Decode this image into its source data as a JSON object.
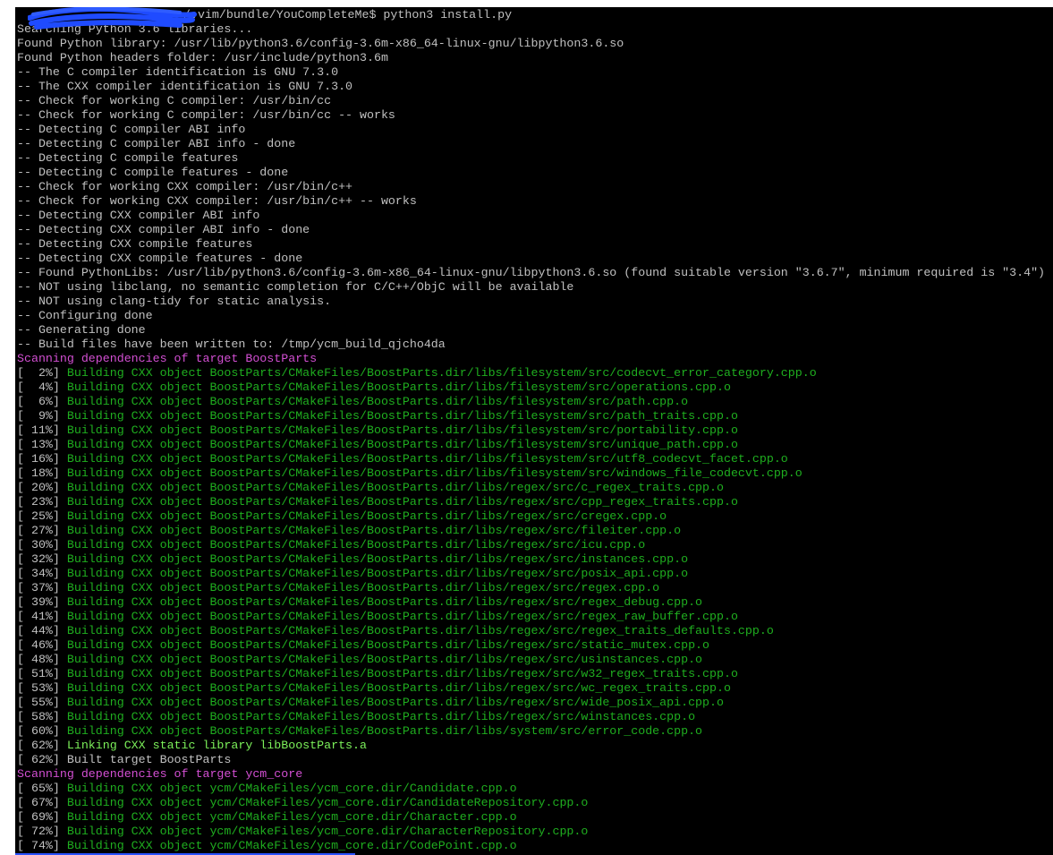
{
  "prompt": {
    "path": "/.vim/bundle/YouCompleteMe$ python3 install.py",
    "redaction_color": "#1f4bff"
  },
  "colors": {
    "background": "#000000",
    "default": "#c0c0c0",
    "magenta": "#d34fd3",
    "green": "#1fae1f",
    "bright_green": "#7cf05a"
  },
  "lines": [
    {
      "progress": "",
      "text": "Searching Python 3.6 libraries...",
      "color": "default"
    },
    {
      "progress": "",
      "text": "Found Python library: /usr/lib/python3.6/config-3.6m-x86_64-linux-gnu/libpython3.6.so",
      "color": "default"
    },
    {
      "progress": "",
      "text": "Found Python headers folder: /usr/include/python3.6m",
      "color": "default"
    },
    {
      "progress": "",
      "text": "-- The C compiler identification is GNU 7.3.0",
      "color": "default"
    },
    {
      "progress": "",
      "text": "-- The CXX compiler identification is GNU 7.3.0",
      "color": "default"
    },
    {
      "progress": "",
      "text": "-- Check for working C compiler: /usr/bin/cc",
      "color": "default"
    },
    {
      "progress": "",
      "text": "-- Check for working C compiler: /usr/bin/cc -- works",
      "color": "default"
    },
    {
      "progress": "",
      "text": "-- Detecting C compiler ABI info",
      "color": "default"
    },
    {
      "progress": "",
      "text": "-- Detecting C compiler ABI info - done",
      "color": "default"
    },
    {
      "progress": "",
      "text": "-- Detecting C compile features",
      "color": "default"
    },
    {
      "progress": "",
      "text": "-- Detecting C compile features - done",
      "color": "default"
    },
    {
      "progress": "",
      "text": "-- Check for working CXX compiler: /usr/bin/c++",
      "color": "default"
    },
    {
      "progress": "",
      "text": "-- Check for working CXX compiler: /usr/bin/c++ -- works",
      "color": "default"
    },
    {
      "progress": "",
      "text": "-- Detecting CXX compiler ABI info",
      "color": "default"
    },
    {
      "progress": "",
      "text": "-- Detecting CXX compiler ABI info - done",
      "color": "default"
    },
    {
      "progress": "",
      "text": "-- Detecting CXX compile features",
      "color": "default"
    },
    {
      "progress": "",
      "text": "-- Detecting CXX compile features - done",
      "color": "default"
    },
    {
      "progress": "",
      "text": "-- Found PythonLibs: /usr/lib/python3.6/config-3.6m-x86_64-linux-gnu/libpython3.6.so (found suitable version \"3.6.7\", minimum required is \"3.4\")",
      "color": "default"
    },
    {
      "progress": "",
      "text": "-- NOT using libclang, no semantic completion for C/C++/ObjC will be available",
      "color": "default"
    },
    {
      "progress": "",
      "text": "-- NOT using clang-tidy for static analysis.",
      "color": "default"
    },
    {
      "progress": "",
      "text": "-- Configuring done",
      "color": "default"
    },
    {
      "progress": "",
      "text": "-- Generating done",
      "color": "default"
    },
    {
      "progress": "",
      "text": "-- Build files have been written to: /tmp/ycm_build_qjcho4da",
      "color": "default"
    },
    {
      "progress": "",
      "text": "Scanning dependencies of target BoostParts",
      "color": "magenta"
    },
    {
      "progress": "[  2%] ",
      "text": "Building CXX object BoostParts/CMakeFiles/BoostParts.dir/libs/filesystem/src/codecvt_error_category.cpp.o",
      "color": "green"
    },
    {
      "progress": "[  4%] ",
      "text": "Building CXX object BoostParts/CMakeFiles/BoostParts.dir/libs/filesystem/src/operations.cpp.o",
      "color": "green"
    },
    {
      "progress": "[  6%] ",
      "text": "Building CXX object BoostParts/CMakeFiles/BoostParts.dir/libs/filesystem/src/path.cpp.o",
      "color": "green"
    },
    {
      "progress": "[  9%] ",
      "text": "Building CXX object BoostParts/CMakeFiles/BoostParts.dir/libs/filesystem/src/path_traits.cpp.o",
      "color": "green"
    },
    {
      "progress": "[ 11%] ",
      "text": "Building CXX object BoostParts/CMakeFiles/BoostParts.dir/libs/filesystem/src/portability.cpp.o",
      "color": "green"
    },
    {
      "progress": "[ 13%] ",
      "text": "Building CXX object BoostParts/CMakeFiles/BoostParts.dir/libs/filesystem/src/unique_path.cpp.o",
      "color": "green"
    },
    {
      "progress": "[ 16%] ",
      "text": "Building CXX object BoostParts/CMakeFiles/BoostParts.dir/libs/filesystem/src/utf8_codecvt_facet.cpp.o",
      "color": "green"
    },
    {
      "progress": "[ 18%] ",
      "text": "Building CXX object BoostParts/CMakeFiles/BoostParts.dir/libs/filesystem/src/windows_file_codecvt.cpp.o",
      "color": "green"
    },
    {
      "progress": "[ 20%] ",
      "text": "Building CXX object BoostParts/CMakeFiles/BoostParts.dir/libs/regex/src/c_regex_traits.cpp.o",
      "color": "green"
    },
    {
      "progress": "[ 23%] ",
      "text": "Building CXX object BoostParts/CMakeFiles/BoostParts.dir/libs/regex/src/cpp_regex_traits.cpp.o",
      "color": "green"
    },
    {
      "progress": "[ 25%] ",
      "text": "Building CXX object BoostParts/CMakeFiles/BoostParts.dir/libs/regex/src/cregex.cpp.o",
      "color": "green"
    },
    {
      "progress": "[ 27%] ",
      "text": "Building CXX object BoostParts/CMakeFiles/BoostParts.dir/libs/regex/src/fileiter.cpp.o",
      "color": "green"
    },
    {
      "progress": "[ 30%] ",
      "text": "Building CXX object BoostParts/CMakeFiles/BoostParts.dir/libs/regex/src/icu.cpp.o",
      "color": "green"
    },
    {
      "progress": "[ 32%] ",
      "text": "Building CXX object BoostParts/CMakeFiles/BoostParts.dir/libs/regex/src/instances.cpp.o",
      "color": "green"
    },
    {
      "progress": "[ 34%] ",
      "text": "Building CXX object BoostParts/CMakeFiles/BoostParts.dir/libs/regex/src/posix_api.cpp.o",
      "color": "green"
    },
    {
      "progress": "[ 37%] ",
      "text": "Building CXX object BoostParts/CMakeFiles/BoostParts.dir/libs/regex/src/regex.cpp.o",
      "color": "green"
    },
    {
      "progress": "[ 39%] ",
      "text": "Building CXX object BoostParts/CMakeFiles/BoostParts.dir/libs/regex/src/regex_debug.cpp.o",
      "color": "green"
    },
    {
      "progress": "[ 41%] ",
      "text": "Building CXX object BoostParts/CMakeFiles/BoostParts.dir/libs/regex/src/regex_raw_buffer.cpp.o",
      "color": "green"
    },
    {
      "progress": "[ 44%] ",
      "text": "Building CXX object BoostParts/CMakeFiles/BoostParts.dir/libs/regex/src/regex_traits_defaults.cpp.o",
      "color": "green"
    },
    {
      "progress": "[ 46%] ",
      "text": "Building CXX object BoostParts/CMakeFiles/BoostParts.dir/libs/regex/src/static_mutex.cpp.o",
      "color": "green"
    },
    {
      "progress": "[ 48%] ",
      "text": "Building CXX object BoostParts/CMakeFiles/BoostParts.dir/libs/regex/src/usinstances.cpp.o",
      "color": "green"
    },
    {
      "progress": "[ 51%] ",
      "text": "Building CXX object BoostParts/CMakeFiles/BoostParts.dir/libs/regex/src/w32_regex_traits.cpp.o",
      "color": "green"
    },
    {
      "progress": "[ 53%] ",
      "text": "Building CXX object BoostParts/CMakeFiles/BoostParts.dir/libs/regex/src/wc_regex_traits.cpp.o",
      "color": "green"
    },
    {
      "progress": "[ 55%] ",
      "text": "Building CXX object BoostParts/CMakeFiles/BoostParts.dir/libs/regex/src/wide_posix_api.cpp.o",
      "color": "green"
    },
    {
      "progress": "[ 58%] ",
      "text": "Building CXX object BoostParts/CMakeFiles/BoostParts.dir/libs/regex/src/winstances.cpp.o",
      "color": "green"
    },
    {
      "progress": "[ 60%] ",
      "text": "Building CXX object BoostParts/CMakeFiles/BoostParts.dir/libs/system/src/error_code.cpp.o",
      "color": "green"
    },
    {
      "progress": "[ 62%] ",
      "text": "Linking CXX static library libBoostParts.a",
      "color": "bright_green"
    },
    {
      "progress": "[ 62%] ",
      "text": "Built target BoostParts",
      "color": "default"
    },
    {
      "progress": "",
      "text": "Scanning dependencies of target ycm_core",
      "color": "magenta"
    },
    {
      "progress": "[ 65%] ",
      "text": "Building CXX object ycm/CMakeFiles/ycm_core.dir/Candidate.cpp.o",
      "color": "green"
    },
    {
      "progress": "[ 67%] ",
      "text": "Building CXX object ycm/CMakeFiles/ycm_core.dir/CandidateRepository.cpp.o",
      "color": "green"
    },
    {
      "progress": "[ 69%] ",
      "text": "Building CXX object ycm/CMakeFiles/ycm_core.dir/Character.cpp.o",
      "color": "green"
    },
    {
      "progress": "[ 72%] ",
      "text": "Building CXX object ycm/CMakeFiles/ycm_core.dir/CharacterRepository.cpp.o",
      "color": "green"
    },
    {
      "progress": "[ 74%] ",
      "text": "Building CXX object ycm/CMakeFiles/ycm_core.dir/CodePoint.cpp.o",
      "color": "green"
    }
  ]
}
